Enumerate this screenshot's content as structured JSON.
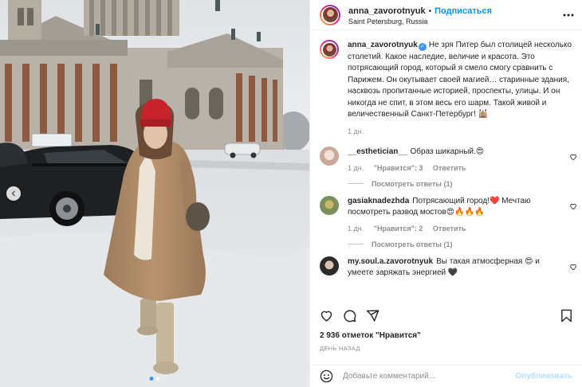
{
  "post": {
    "username": "anna_zavorotnyuk",
    "follow_label": "Подписаться",
    "location": "Saint Petersburg, Russia",
    "caption": "Не зря Питер был столицей несколько столетий. Какое наследие, величие и красота. Это потрясающий город, который я смело смогу сравнить с Парижем. Он окутывает своей магией… старинные здания, насквозь пропитанные историей, проспекты, улицы. И он никогда не спит, в этом весь его шарм. Такой живой и величественный Санкт-Петербург! 🕍",
    "caption_time": "1 дн.",
    "likes": "2 936 отметок \"Нравится\"",
    "date": "ДЕНЬ НАЗАД",
    "photo_dots": 2,
    "photo_active_dot": 1
  },
  "comments": [
    {
      "username": "__esthetician__",
      "text": "Образ шикарный.😍",
      "time": "1 дн.",
      "likes": "\"Нравится\": 3",
      "reply_label": "Ответить",
      "replies_label": "Посмотреть ответы (1)"
    },
    {
      "username": "gasiaknadezhda",
      "text": "Потрясающий город!❤️ Мечтаю посмотреть развод мостов😍🔥🔥🔥",
      "time": "1 дн.",
      "likes": "\"Нравится\": 2",
      "reply_label": "Ответить",
      "replies_label": "Посмотреть ответы (1)"
    },
    {
      "username": "my.soul.a.zavorotnyuk",
      "text": "Вы такая атмосферная 😍 и умеете заряжать энергией 🖤"
    }
  ],
  "add_comment": {
    "placeholder": "Добавьте комментарий...",
    "publish_label": "Опубликовать"
  },
  "colors": {
    "accent": "#0095f6",
    "verified": "#3897f0",
    "hat": "#c8232c",
    "coat": "#b08968"
  },
  "icons": {
    "like": "heart-icon",
    "comment": "comment-icon",
    "share": "share-icon",
    "save": "bookmark-icon",
    "more": "more-icon",
    "emoji": "emoji-icon",
    "prev": "chevron-left-icon"
  }
}
